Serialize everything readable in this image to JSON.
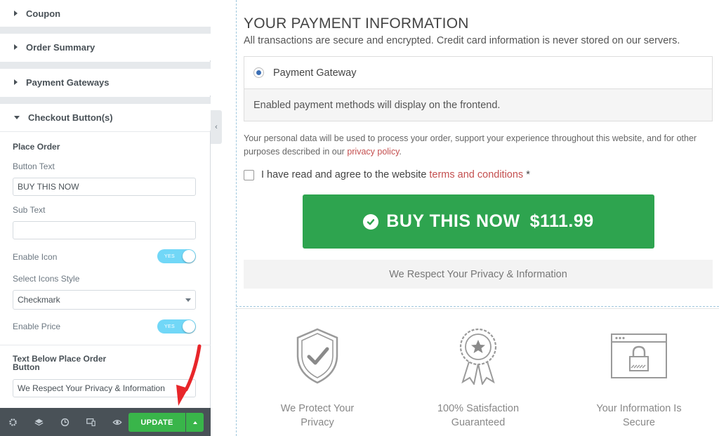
{
  "panel": {
    "sections": {
      "coupon": "Coupon",
      "order_summary": "Order Summary",
      "payment_gateways": "Payment Gateways",
      "checkout_buttons": "Checkout Button(s)"
    },
    "place_order": {
      "heading": "Place Order",
      "button_text_label": "Button Text",
      "button_text_value": "BUY THIS NOW",
      "sub_text_label": "Sub Text",
      "sub_text_value": "",
      "enable_icon_label": "Enable Icon",
      "enable_icon_state": "YES",
      "select_icons_style_label": "Select Icons Style",
      "select_icons_style_value": "Checkmark",
      "enable_price_label": "Enable Price",
      "enable_price_state": "YES"
    },
    "text_below": {
      "heading": "Text Below Place Order Button",
      "value": "We Respect Your Privacy & Information"
    },
    "toolbar": {
      "icons": [
        "gear-icon",
        "layers-icon",
        "history-icon",
        "responsive-icon",
        "eye-icon"
      ],
      "update_label": "UPDATE"
    }
  },
  "preview": {
    "title": "YOUR PAYMENT INFORMATION",
    "subtitle": "All transactions are secure and encrypted. Credit card information is never stored on our servers.",
    "gateway_label": "Payment Gateway",
    "gateway_description": "Enabled payment methods will display on the frontend.",
    "privacy_text_before": "Your personal data will be used to process your order, support your experience throughout this website, and for other purposes described in our ",
    "privacy_link": "privacy policy",
    "privacy_text_after": ".",
    "terms_before": "I have read and agree to the website ",
    "terms_link": "terms and conditions",
    "terms_required": " *",
    "buy_button_label": "BUY THIS NOW",
    "buy_button_price": "$111.99",
    "respect_text": "We Respect Your Privacy & Information",
    "badges": [
      {
        "icon": "shield-check-icon",
        "line1": "We Protect Your",
        "line2": "Privacy"
      },
      {
        "icon": "award-ribbon-icon",
        "line1": "100% Satisfaction",
        "line2": "Guaranteed"
      },
      {
        "icon": "browser-lock-icon",
        "line1": "Your Information Is",
        "line2": "Secure"
      }
    ]
  },
  "colors": {
    "update_green": "#39b54a",
    "buy_green": "#2ea44f",
    "toggle_blue": "#71d7f7",
    "link_red": "#c44f4f",
    "annotation_arrow": "#e8262a"
  }
}
